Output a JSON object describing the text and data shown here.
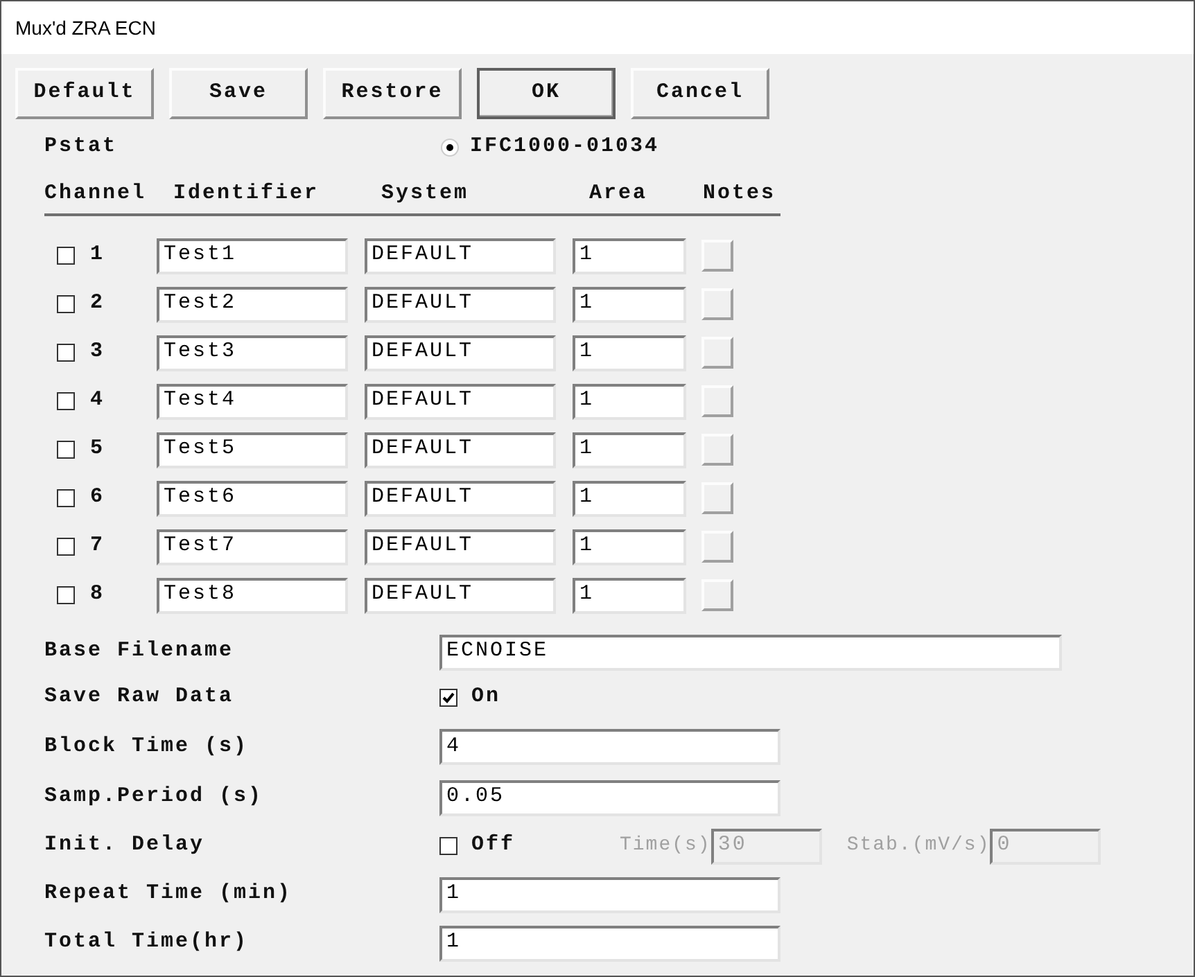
{
  "window": {
    "title": "Mux'd ZRA ECN"
  },
  "buttons": [
    {
      "label": "Default",
      "default": false
    },
    {
      "label": "Save",
      "default": false
    },
    {
      "label": "Restore",
      "default": false
    },
    {
      "label": "OK",
      "default": true
    },
    {
      "label": "Cancel",
      "default": false
    }
  ],
  "pstat": {
    "label": "Pstat",
    "option": {
      "label": "IFC1000-01034",
      "selected": true
    }
  },
  "channel_table": {
    "columns": [
      "Channel",
      "Identifier",
      "System",
      "Area",
      "Notes"
    ],
    "rows": [
      {
        "channel": "1",
        "checked": false,
        "identifier": "Test1",
        "system": "DEFAULT",
        "area": "1"
      },
      {
        "channel": "2",
        "checked": false,
        "identifier": "Test2",
        "system": "DEFAULT",
        "area": "1"
      },
      {
        "channel": "3",
        "checked": false,
        "identifier": "Test3",
        "system": "DEFAULT",
        "area": "1"
      },
      {
        "channel": "4",
        "checked": false,
        "identifier": "Test4",
        "system": "DEFAULT",
        "area": "1"
      },
      {
        "channel": "5",
        "checked": false,
        "identifier": "Test5",
        "system": "DEFAULT",
        "area": "1"
      },
      {
        "channel": "6",
        "checked": false,
        "identifier": "Test6",
        "system": "DEFAULT",
        "area": "1"
      },
      {
        "channel": "7",
        "checked": false,
        "identifier": "Test7",
        "system": "DEFAULT",
        "area": "1"
      },
      {
        "channel": "8",
        "checked": false,
        "identifier": "Test8",
        "system": "DEFAULT",
        "area": "1"
      }
    ]
  },
  "settings": [
    {
      "kind": "long-field",
      "label": "Base Filename",
      "value": "ECNOISE"
    },
    {
      "kind": "checkbox",
      "label": "Save Raw Data",
      "checked": true,
      "text": "On"
    },
    {
      "kind": "field",
      "label": "Block Time (s)",
      "value": "4"
    },
    {
      "kind": "field",
      "label": "Samp.Period (s)",
      "value": "0.05"
    },
    {
      "kind": "delay",
      "label": "Init. Delay",
      "checked": false,
      "text": "Off",
      "time_label": "Time(s)",
      "time_value": "30",
      "stab_label": "Stab.(mV/s)",
      "stab_value": "0",
      "disabled": true
    },
    {
      "kind": "field",
      "label": "Repeat Time (min)",
      "value": "1"
    },
    {
      "kind": "field",
      "label": "Total Time(hr)",
      "value": "1"
    }
  ]
}
